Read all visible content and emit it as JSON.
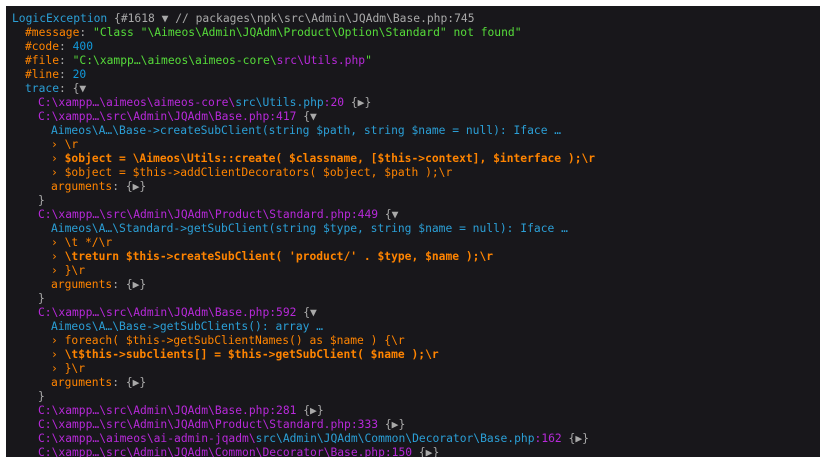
{
  "colors": {
    "background": "#18171b",
    "class": "#2b9fd6",
    "key": "#ff8400",
    "string": "#56db3a",
    "number": "#1299da",
    "path": "#b729d9",
    "punct": "#a9a9a9"
  },
  "dump": [
    {
      "indent": 0,
      "segs": [
        [
          "fn",
          "LogicException"
        ],
        [
          "pu",
          " {#1618 ▼ // packages\\npk\\src\\Admin\\JQAdm\\Base.php:745"
        ]
      ]
    },
    {
      "indent": 1,
      "segs": [
        [
          "tx",
          "#message"
        ],
        [
          "pu",
          ": "
        ],
        [
          "tk",
          "\"Class \"\\Aimeos\\Admin\\JQAdm\\Product\\Option\\Standard\" not found\""
        ]
      ]
    },
    {
      "indent": 1,
      "segs": [
        [
          "tx",
          "#code"
        ],
        [
          "pu",
          ": "
        ],
        [
          "nm",
          "400"
        ]
      ]
    },
    {
      "indent": 1,
      "segs": [
        [
          "tx",
          "#file"
        ],
        [
          "pu",
          ": "
        ],
        [
          "tk",
          "\"C:\\xampp…\\aimeos\\aimeos-core\\"
        ],
        [
          "pa",
          "src\\Utils.php"
        ],
        [
          "tk",
          "\""
        ]
      ]
    },
    {
      "indent": 1,
      "segs": [
        [
          "tx",
          "#line"
        ],
        [
          "pu",
          ": "
        ],
        [
          "nm",
          "20"
        ]
      ]
    },
    {
      "indent": 1,
      "segs": [
        [
          "fn",
          "trace"
        ],
        [
          "pu",
          ": {▼"
        ]
      ]
    },
    {
      "indent": 2,
      "segs": [
        [
          "pa",
          "C:\\xampp…\\aimeos\\aimeos-core\\"
        ],
        [
          "fn",
          "src\\Utils.php"
        ],
        [
          "pa",
          ":20"
        ],
        [
          "pu",
          " {▶}"
        ]
      ]
    },
    {
      "indent": 2,
      "segs": [
        [
          "pa",
          "C:\\xampp…\\src\\Admin\\JQAdm\\Base.php:417"
        ],
        [
          "pu",
          " {▼"
        ]
      ]
    },
    {
      "indent": 3,
      "segs": [
        [
          "fn",
          "Aimeos\\A…\\Base->createSubClient(string $path, string $name = null): Iface …"
        ]
      ]
    },
    {
      "indent": 3,
      "segs": [
        [
          "tx",
          "› \\r"
        ]
      ]
    },
    {
      "indent": 3,
      "segs": [
        [
          "tx",
          "› "
        ],
        [
          "tx bd",
          "$object = \\Aimeos\\Utils::create( $classname, [$this->context], $interface );\\r"
        ]
      ]
    },
    {
      "indent": 3,
      "segs": [
        [
          "tx",
          "› $object = $this->addClientDecorators( $object, $path );\\r"
        ]
      ]
    },
    {
      "indent": 3,
      "segs": [
        [
          "tx",
          "arguments"
        ],
        [
          "pu",
          ": {▶}"
        ]
      ]
    },
    {
      "indent": 2,
      "segs": [
        [
          "pu",
          "}"
        ]
      ]
    },
    {
      "indent": 2,
      "segs": [
        [
          "pa",
          "C:\\xampp…\\src\\Admin\\JQAdm\\Product\\Standard.php:449"
        ],
        [
          "pu",
          " {▼"
        ]
      ]
    },
    {
      "indent": 3,
      "segs": [
        [
          "fn",
          "Aimeos\\A…\\Standard->getSubClient(string $type, string $name = null): Iface …"
        ]
      ]
    },
    {
      "indent": 3,
      "segs": [
        [
          "tx",
          "› \\t */\\r"
        ]
      ]
    },
    {
      "indent": 3,
      "segs": [
        [
          "tx",
          "› "
        ],
        [
          "tx bd",
          "\\treturn $this->createSubClient( 'product/' . $type, $name );\\r"
        ]
      ]
    },
    {
      "indent": 3,
      "segs": [
        [
          "tx",
          "› }\\r"
        ]
      ]
    },
    {
      "indent": 3,
      "segs": [
        [
          "tx",
          "arguments"
        ],
        [
          "pu",
          ": {▶}"
        ]
      ]
    },
    {
      "indent": 2,
      "segs": [
        [
          "pu",
          "}"
        ]
      ]
    },
    {
      "indent": 2,
      "segs": [
        [
          "pa",
          "C:\\xampp…\\src\\Admin\\JQAdm\\Base.php:592"
        ],
        [
          "pu",
          " {▼"
        ]
      ]
    },
    {
      "indent": 3,
      "segs": [
        [
          "fn",
          "Aimeos\\A…\\Base->getSubClients(): array …"
        ]
      ]
    },
    {
      "indent": 3,
      "segs": [
        [
          "tx",
          "› foreach( $this->getSubClientNames() as $name ) {\\r"
        ]
      ]
    },
    {
      "indent": 3,
      "segs": [
        [
          "tx",
          "› "
        ],
        [
          "tx bd",
          "\\t$this->subclients[] = $this->getSubClient( $name );\\r"
        ]
      ]
    },
    {
      "indent": 3,
      "segs": [
        [
          "tx",
          "› }\\r"
        ]
      ]
    },
    {
      "indent": 3,
      "segs": [
        [
          "tx",
          "arguments"
        ],
        [
          "pu",
          ": {▶}"
        ]
      ]
    },
    {
      "indent": 2,
      "segs": [
        [
          "pu",
          "}"
        ]
      ]
    },
    {
      "indent": 2,
      "segs": [
        [
          "pa",
          "C:\\xampp…\\src\\Admin\\JQAdm\\Base.php:281"
        ],
        [
          "pu",
          " {▶}"
        ]
      ]
    },
    {
      "indent": 2,
      "segs": [
        [
          "pa",
          "C:\\xampp…\\src\\Admin\\JQAdm\\Product\\Standard.php:333"
        ],
        [
          "pu",
          " {▶}"
        ]
      ]
    },
    {
      "indent": 2,
      "segs": [
        [
          "pa",
          "C:\\xampp…\\aimeos\\ai-admin-jqadm\\"
        ],
        [
          "fn",
          "src\\Admin\\JQAdm\\Common\\Decorator\\Base.php"
        ],
        [
          "pa",
          ":162"
        ],
        [
          "pu",
          " {▶}"
        ]
      ]
    },
    {
      "indent": 2,
      "segs": [
        [
          "pa",
          "C:\\xampp…\\src\\Admin\\JQAdm\\Common\\Decorator\\Base.php:150"
        ],
        [
          "pu",
          " {▶}"
        ]
      ]
    }
  ]
}
